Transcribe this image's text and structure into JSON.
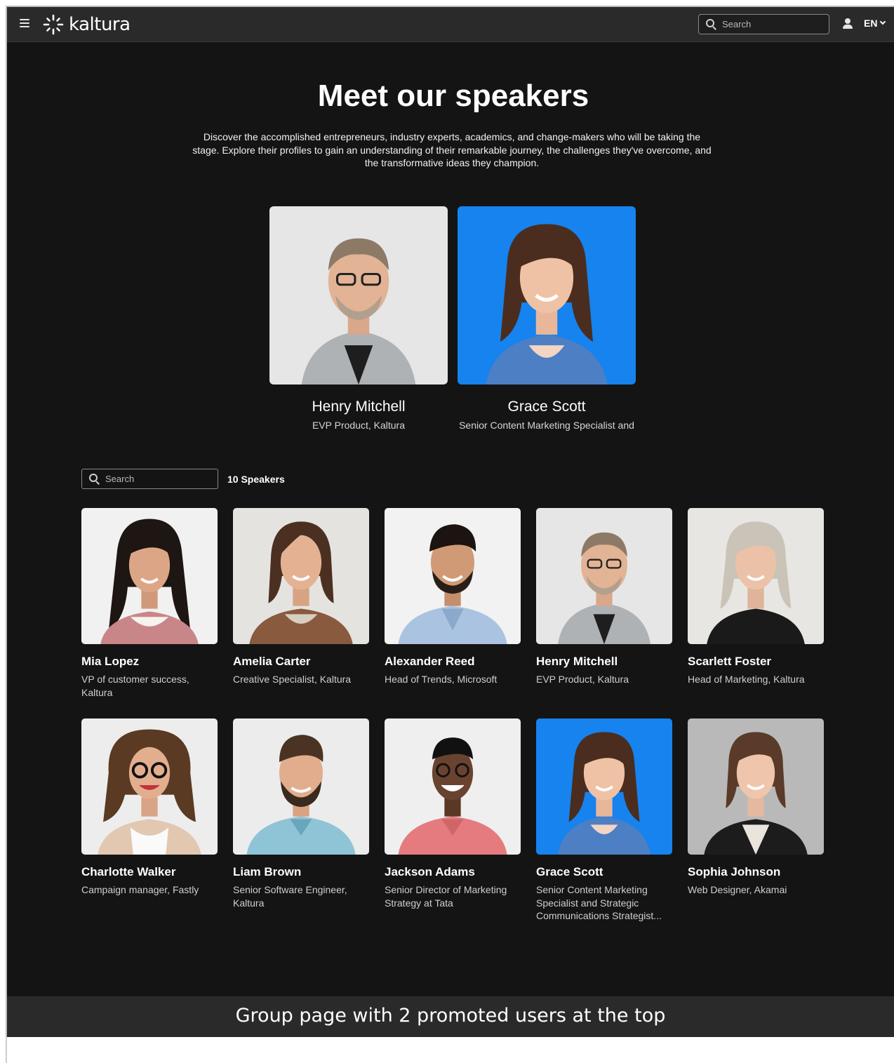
{
  "header": {
    "logo_text": "kaltura",
    "search_placeholder": "Search",
    "language": "EN"
  },
  "hero": {
    "title": "Meet our speakers",
    "description": "Discover the accomplished entrepreneurs, industry experts, academics, and change-makers who will be taking the stage. Explore their profiles to gain an understanding of their remarkable journey, the challenges they've overcome, and the transformative ideas they champion."
  },
  "promoted": [
    {
      "name": "Henry Mitchell",
      "title": "EVP Product, Kaltura"
    },
    {
      "name": "Grace Scott",
      "title": "Senior Content Marketing Specialist and"
    }
  ],
  "list": {
    "search_placeholder": "Search",
    "count_label": "10 Speakers"
  },
  "speakers": [
    {
      "name": "Mia Lopez",
      "title": "VP of customer success, Kaltura"
    },
    {
      "name": "Amelia Carter",
      "title": "Creative Specialist, Kaltura"
    },
    {
      "name": "Alexander Reed",
      "title": "Head of Trends, Microsoft"
    },
    {
      "name": "Henry Mitchell",
      "title": "EVP Product, Kaltura"
    },
    {
      "name": "Scarlett Foster",
      "title": "Head of Marketing, Kaltura"
    },
    {
      "name": "Charlotte Walker",
      "title": "Campaign manager, Fastly"
    },
    {
      "name": "Liam Brown",
      "title": "Senior Software Engineer, Kaltura"
    },
    {
      "name": "Jackson Adams",
      "title": "Senior Director of Marketing Strategy at Tata"
    },
    {
      "name": "Grace Scott",
      "title": "Senior Content Marketing Specialist and Strategic Communications Strategist..."
    },
    {
      "name": "Sophia Johnson",
      "title": "Web Designer, Akamai"
    }
  ],
  "caption": "Group page with 2 promoted users at the top",
  "colors": {
    "page_background": "#141414",
    "header_background": "#2a2a2a",
    "accent_blue": "#1683ee"
  }
}
